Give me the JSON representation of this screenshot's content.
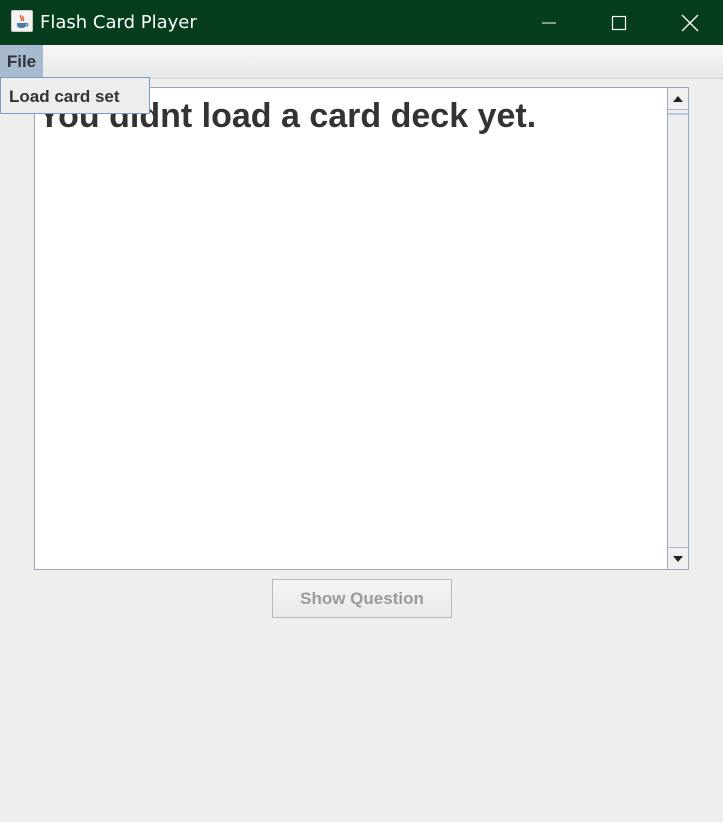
{
  "window": {
    "title": "Flash Card Player",
    "title_bar_color": "#063d1c",
    "app_icon": "java-app-icon",
    "controls": {
      "minimize_icon": "minimize-icon",
      "maximize_icon": "maximize-icon",
      "close_icon": "close-icon"
    }
  },
  "menubar": {
    "menus": [
      {
        "label": "File",
        "open": true
      }
    ]
  },
  "file_menu": {
    "items": [
      {
        "label": "Load card set"
      }
    ]
  },
  "card_area": {
    "text": "You didnt load a card deck yet.",
    "scrollbar": {
      "up_icon": "arrow-up-icon",
      "down_icon": "arrow-down-icon"
    }
  },
  "buttons": {
    "show_question": {
      "label": "Show Question",
      "enabled": false
    }
  },
  "colors": {
    "menu_highlight": "#a8bad0",
    "menu_border": "#7d9cc4",
    "disabled_text": "#9a9a9a"
  }
}
